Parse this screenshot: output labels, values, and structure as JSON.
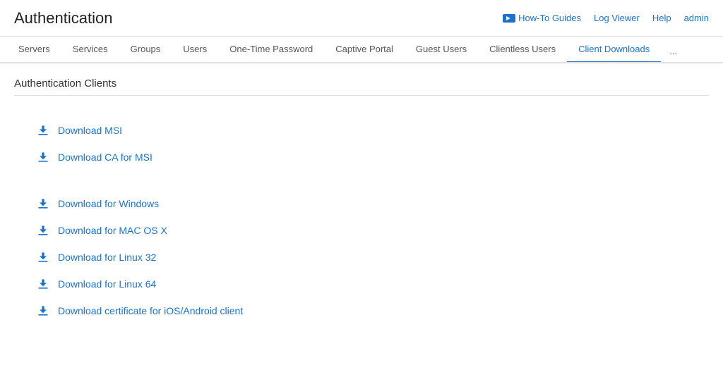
{
  "header": {
    "title": "Authentication",
    "nav": {
      "how_to_guides": "How-To Guides",
      "log_viewer": "Log Viewer",
      "help": "Help",
      "admin": "admin"
    }
  },
  "tabs": [
    {
      "id": "servers",
      "label": "Servers",
      "active": false
    },
    {
      "id": "services",
      "label": "Services",
      "active": false
    },
    {
      "id": "groups",
      "label": "Groups",
      "active": false
    },
    {
      "id": "users",
      "label": "Users",
      "active": false
    },
    {
      "id": "one-time-password",
      "label": "One-Time Password",
      "active": false
    },
    {
      "id": "captive-portal",
      "label": "Captive Portal",
      "active": false
    },
    {
      "id": "guest-users",
      "label": "Guest Users",
      "active": false
    },
    {
      "id": "clientless-users",
      "label": "Clientless Users",
      "active": false
    },
    {
      "id": "client-downloads",
      "label": "Client Downloads",
      "active": true
    },
    {
      "id": "more",
      "label": "...",
      "active": false
    }
  ],
  "section_title": "Authentication Clients",
  "downloads": {
    "group1": [
      {
        "id": "msi",
        "label": "Download MSI"
      },
      {
        "id": "ca-msi",
        "label": "Download CA for MSI"
      }
    ],
    "group2": [
      {
        "id": "windows",
        "label": "Download for Windows"
      },
      {
        "id": "mac",
        "label": "Download for MAC OS X"
      },
      {
        "id": "linux32",
        "label": "Download for Linux 32"
      },
      {
        "id": "linux64",
        "label": "Download for Linux 64"
      },
      {
        "id": "ios-android",
        "label": "Download certificate for iOS/Android client"
      }
    ]
  },
  "colors": {
    "accent": "#1a73c8",
    "active_tab_border": "#1a73c8"
  }
}
